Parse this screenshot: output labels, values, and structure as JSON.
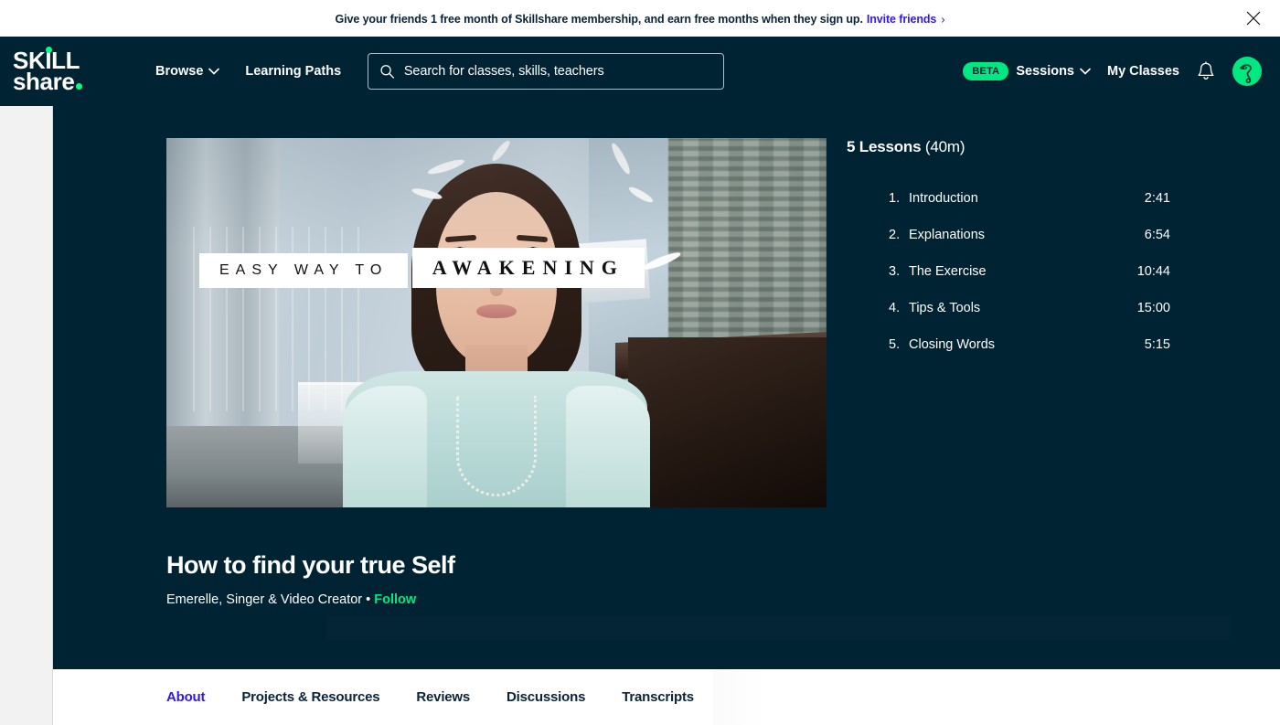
{
  "promo": {
    "message": "Give your friends 1 free month of Skillshare membership, and earn free months when they sign up.",
    "link_label": "Invite friends",
    "chevron": "›",
    "close_icon": "close-icon",
    "link_color": "#2f19e8"
  },
  "nav": {
    "logo_line1": "SKILL",
    "logo_line2": "share",
    "browse_label": "Browse",
    "learning_paths_label": "Learning Paths",
    "beta_badge": "BETA",
    "sessions_label": "Sessions",
    "my_classes_label": "My Classes",
    "notifications_icon": "bell-icon",
    "avatar_icon": "avatar",
    "accent_green": "#00e881",
    "background": "#002333"
  },
  "search": {
    "placeholder": "Search for classes, skills, teachers",
    "value": "",
    "icon": "search-icon"
  },
  "hero": {
    "video": {
      "overlay_line1": "EASY WAY TO",
      "overlay_line2": "AWAKENING"
    },
    "class_title": "How to find your true Self",
    "author": "Emerelle, Singer & Video Creator",
    "separator": "•",
    "follow_label": "Follow",
    "follow_color": "#00e881"
  },
  "lessons": {
    "count_label": "5 Lessons",
    "duration_label": "(40m)",
    "items": [
      {
        "num": "1.",
        "title": "Introduction",
        "time": "2:41"
      },
      {
        "num": "2.",
        "title": "Explanations",
        "time": "6:54"
      },
      {
        "num": "3.",
        "title": "The Exercise",
        "time": "10:44"
      },
      {
        "num": "4.",
        "title": "Tips & Tools",
        "time": "15:00"
      },
      {
        "num": "5.",
        "title": "Closing Words",
        "time": "5:15"
      }
    ]
  },
  "tabs": [
    {
      "label": "About",
      "active": true
    },
    {
      "label": "Projects & Resources",
      "active": false
    },
    {
      "label": "Reviews",
      "active": false
    },
    {
      "label": "Discussions",
      "active": false
    },
    {
      "label": "Transcripts",
      "active": false
    }
  ]
}
